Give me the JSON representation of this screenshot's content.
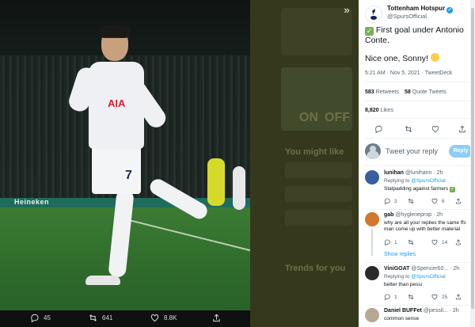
{
  "tweet": {
    "author_name": "Tottenham Hotspur",
    "handle": "@SpursOfficial",
    "text_line1": "First goal under Antonio Conte.",
    "text_line2": "Nice one, Sonny!",
    "meta": "5:21 AM · Nov 5, 2021 · TweetDeck",
    "retweets_count": "583",
    "retweets_label": "Retweets",
    "quotes_count": "58",
    "quotes_label": "Quote Tweets",
    "likes_count": "8,820",
    "likes_label": "Likes"
  },
  "media": {
    "sponsor": "AIA",
    "shirt_number": "7",
    "board_text": "Heineken",
    "replies": "45",
    "retweets": "641",
    "likes": "8.8K"
  },
  "reply_box": {
    "placeholder": "Tweet your reply",
    "button": "Reply"
  },
  "replies": [
    {
      "name": "lunihan",
      "handle": "@lunihann",
      "time": "· 2h",
      "replying_label": "Replying to",
      "replying_to": "@SpursOfficial",
      "text": "Statpadding against farmers",
      "reply_count": "3",
      "retweet_count": "",
      "like_count": "6",
      "avatar_color": "#3a5f9e"
    },
    {
      "name": "gab",
      "handle": "@hygleneprop",
      "time": "· 2h",
      "replying_label": "Replying to",
      "replying_to": "@SpursOfficial",
      "text": "why are all your replies the same ffs man come up with better material",
      "reply_count": "1",
      "retweet_count": "",
      "like_count": "14",
      "avatar_color": "#d0782e"
    },
    {
      "name": "ViniGOAT",
      "handle": "@Spencer60...",
      "time": "· 2h",
      "replying_label": "Replying to",
      "replying_to": "@SpursOfficial",
      "text": "better than pessi",
      "reply_count": "1",
      "retweet_count": "",
      "like_count": "25",
      "avatar_color": "#2a2a2a"
    },
    {
      "name": "Daniel BUFFet",
      "handle": "@pessil...",
      "time": "· 2h",
      "text": "common sense",
      "avatar_color": "#b7a796"
    }
  ],
  "show_replies": "Show replies",
  "background": {
    "you_might_like": "You might like",
    "trends": "Trends for you",
    "on": "ON",
    "off": "OFF"
  },
  "colors": {
    "twitter_blue": "#1d9bf0",
    "verified": "#1d9bf0",
    "check_green": "#77b255"
  }
}
